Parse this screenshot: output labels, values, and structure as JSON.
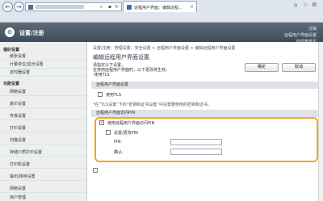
{
  "browser": {
    "back": "←",
    "forward": "→",
    "tab_title": "远程用户界面：编辑远程...",
    "tab_close": "×",
    "window_controls": [
      "⌂",
      "☆",
      "⚙"
    ]
  },
  "header": {
    "logo": "⚙",
    "title": "设置/注册",
    "links": [
      "注销",
      "远程用户界面设置",
      "收件箱首页"
    ]
  },
  "sidebar": {
    "heading1": "偏好设置",
    "items_a": [
      "纸张设置",
      "计量单位/显示设置",
      "定时器设置"
    ],
    "heading2": "功能设置",
    "items_b": [
      "网络设置",
      "复印设置",
      "传真设置",
      "打印设置",
      "扫描设置",
      "存储介质打印设置",
      "打印机设置",
      "输出/排序设置",
      "网络设置",
      "用户管理"
    ]
  },
  "main": {
    "breadcrumb": "设置/注册：管理设置：安全设置 > 远程用户界面设置 > 编辑远程用户界面设置",
    "title": "编辑远程用户界面设置",
    "ok_label": "确定",
    "cancel_label": "取消",
    "note_lines": [
      "请指定以下设置。",
      "在使用远程用户界面时，以下更改将生效。",
      "·使用TLS"
    ],
    "section1": "远程用户界面设置",
    "use_tls_label": "使用TLS",
    "hint": "*在“TLS设置”下的“密钥和证书设置”中设置要使用的密钥和证书。",
    "section2": "远程用户界面访问PIN",
    "use_pin_label": "使用远程用户界面访问PIN",
    "use_pin_checked": true,
    "set_pin_label": "设置/更改PIN",
    "set_pin_checked": false,
    "pin_label": "PIN:",
    "confirm_label": "确认:"
  }
}
